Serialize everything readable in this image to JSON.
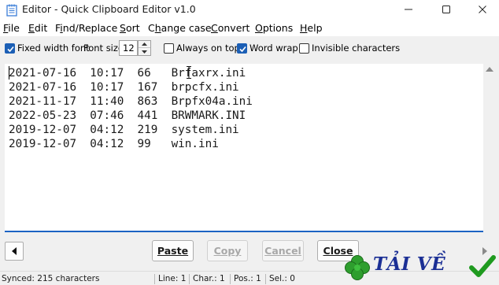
{
  "window": {
    "title": "Editor - Quick Clipboard Editor v1.0"
  },
  "menu": [
    {
      "pre": "",
      "ul": "F",
      "post": "ile"
    },
    {
      "pre": "",
      "ul": "E",
      "post": "dit"
    },
    {
      "pre": "F",
      "ul": "i",
      "post": "nd/Replace"
    },
    {
      "pre": "",
      "ul": "S",
      "post": "ort"
    },
    {
      "pre": "C",
      "ul": "h",
      "post": "ange case"
    },
    {
      "pre": "",
      "ul": "C",
      "post": "onvert"
    },
    {
      "pre": "",
      "ul": "O",
      "post": "ptions"
    },
    {
      "pre": "",
      "ul": "H",
      "post": "elp"
    }
  ],
  "toolbar": {
    "fixed_width_font": {
      "label": "Fixed width font",
      "checked": true
    },
    "font_size_label": "Font size",
    "font_size_value": "12",
    "always_on_top": {
      "label": "Always on top",
      "checked": false
    },
    "word_wrap": {
      "label": "Word wrap",
      "checked": true
    },
    "invisible_characters": {
      "label": "Invisible characters",
      "checked": false
    }
  },
  "editor": {
    "lines": [
      "2021-07-16  10:17  66   Brfaxrx.ini",
      "2021-07-16  10:17  167  brpcfx.ini",
      "2021-11-17  11:40  863  Brpfx04a.ini",
      "2022-05-23  07:46  441  BRWMARK.INI",
      "2019-12-07  04:12  219  system.ini",
      "2019-12-07  04:12  99   win.ini"
    ]
  },
  "buttons": {
    "paste": "Paste",
    "copy": "Copy",
    "cancel": "Cancel",
    "close": "Close"
  },
  "status": {
    "synced": "Synced: 215 characters",
    "line": "Line: 1",
    "char": "Char.: 1",
    "pos": "Pos.: 1",
    "sel": "Sel.: 0"
  },
  "watermark": {
    "text": "TẢI VỀ"
  },
  "colors": {
    "accent": "#1c63c3",
    "checkbox_on": "#1c5fb5",
    "watermark_text": "#1b2f95",
    "clover": "#2e9e2e",
    "checkmark": "#1f9a1f"
  }
}
